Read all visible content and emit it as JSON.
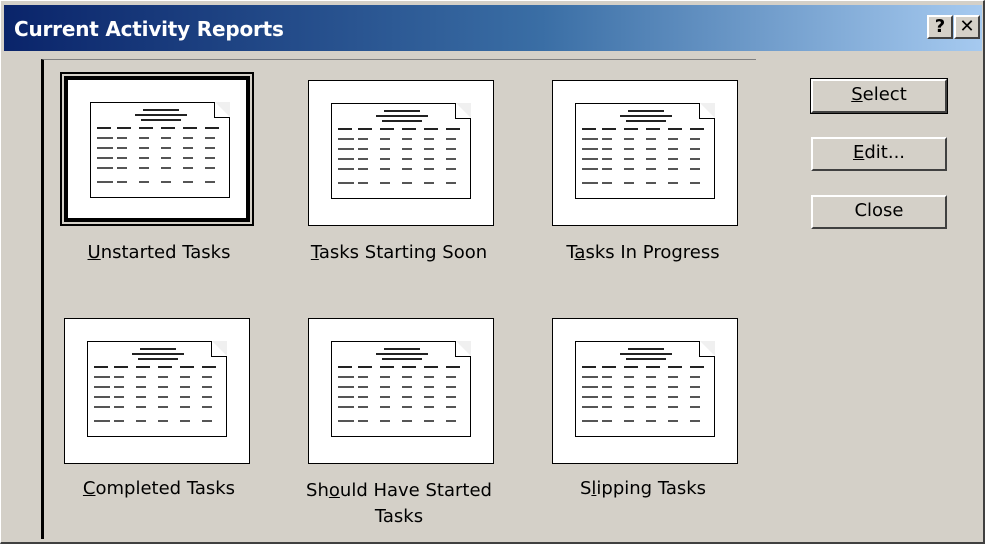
{
  "window": {
    "title": "Current Activity Reports",
    "help_glyph": "?",
    "close_glyph": "✕"
  },
  "reports": [
    {
      "label": "Unstarted Tasks",
      "mnemonic_index": 0,
      "selected": true
    },
    {
      "label": "Tasks Starting Soon",
      "mnemonic_index": 0,
      "selected": false
    },
    {
      "label": "Tasks In Progress",
      "mnemonic_index": 1,
      "selected": false
    },
    {
      "label": "Completed Tasks",
      "mnemonic_index": 0,
      "selected": false
    },
    {
      "label": "Should Have Started Tasks",
      "mnemonic_index": 2,
      "selected": false
    },
    {
      "label": "Slipping Tasks",
      "mnemonic_index": 1,
      "selected": false
    }
  ],
  "buttons": {
    "select": "Select",
    "edit": "Edit...",
    "close": "Close"
  }
}
